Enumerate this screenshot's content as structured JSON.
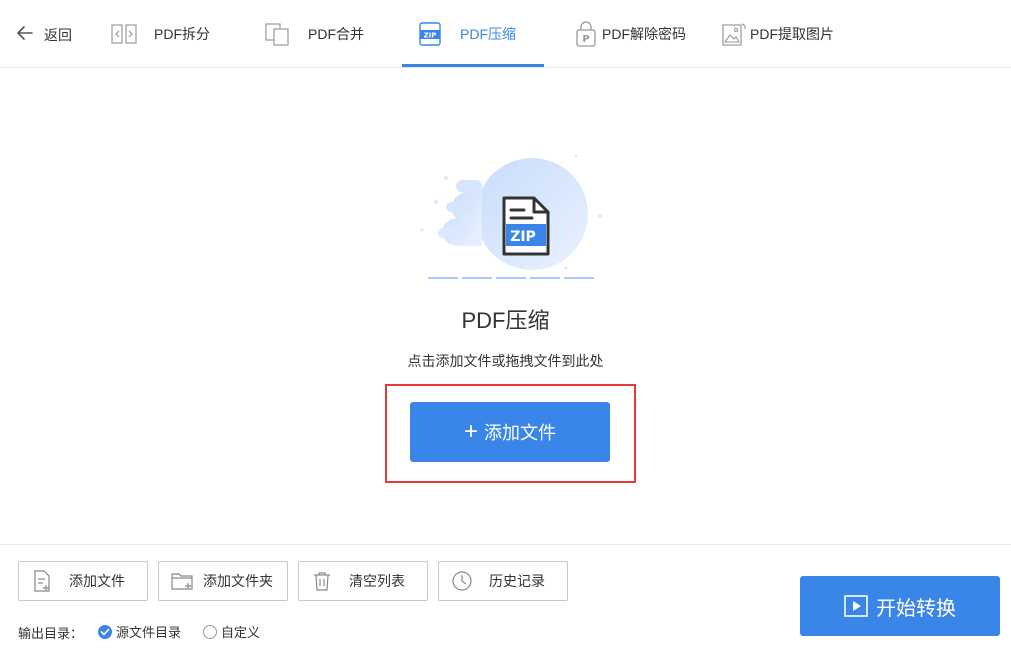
{
  "header": {
    "back_label": "返回",
    "tabs": [
      {
        "label": "PDF拆分",
        "icon": "split-icon"
      },
      {
        "label": "PDF合并",
        "icon": "merge-icon"
      },
      {
        "label": "PDF压缩",
        "icon": "zip-icon",
        "active": true
      },
      {
        "label": "PDF解除密码",
        "icon": "password-icon"
      },
      {
        "label": "PDF提取图片",
        "icon": "image-icon"
      }
    ]
  },
  "main": {
    "hero_icon_text": "ZIP",
    "title": "PDF压缩",
    "hint": "点击添加文件或拖拽文件到此处",
    "add_button_label": "添加文件"
  },
  "toolbar": {
    "buttons": [
      {
        "label": "添加文件",
        "icon": "add-file-icon"
      },
      {
        "label": "添加文件夹",
        "icon": "add-folder-icon"
      },
      {
        "label": "清空列表",
        "icon": "trash-icon"
      },
      {
        "label": "历史记录",
        "icon": "clock-icon"
      }
    ],
    "output_label": "输出目录：",
    "output_options": [
      {
        "label": "源文件目录",
        "checked": true
      },
      {
        "label": "自定义",
        "checked": false
      }
    ],
    "start_label": "开始转换"
  },
  "colors": {
    "accent": "#3a86e8",
    "highlight": "#e53935"
  }
}
